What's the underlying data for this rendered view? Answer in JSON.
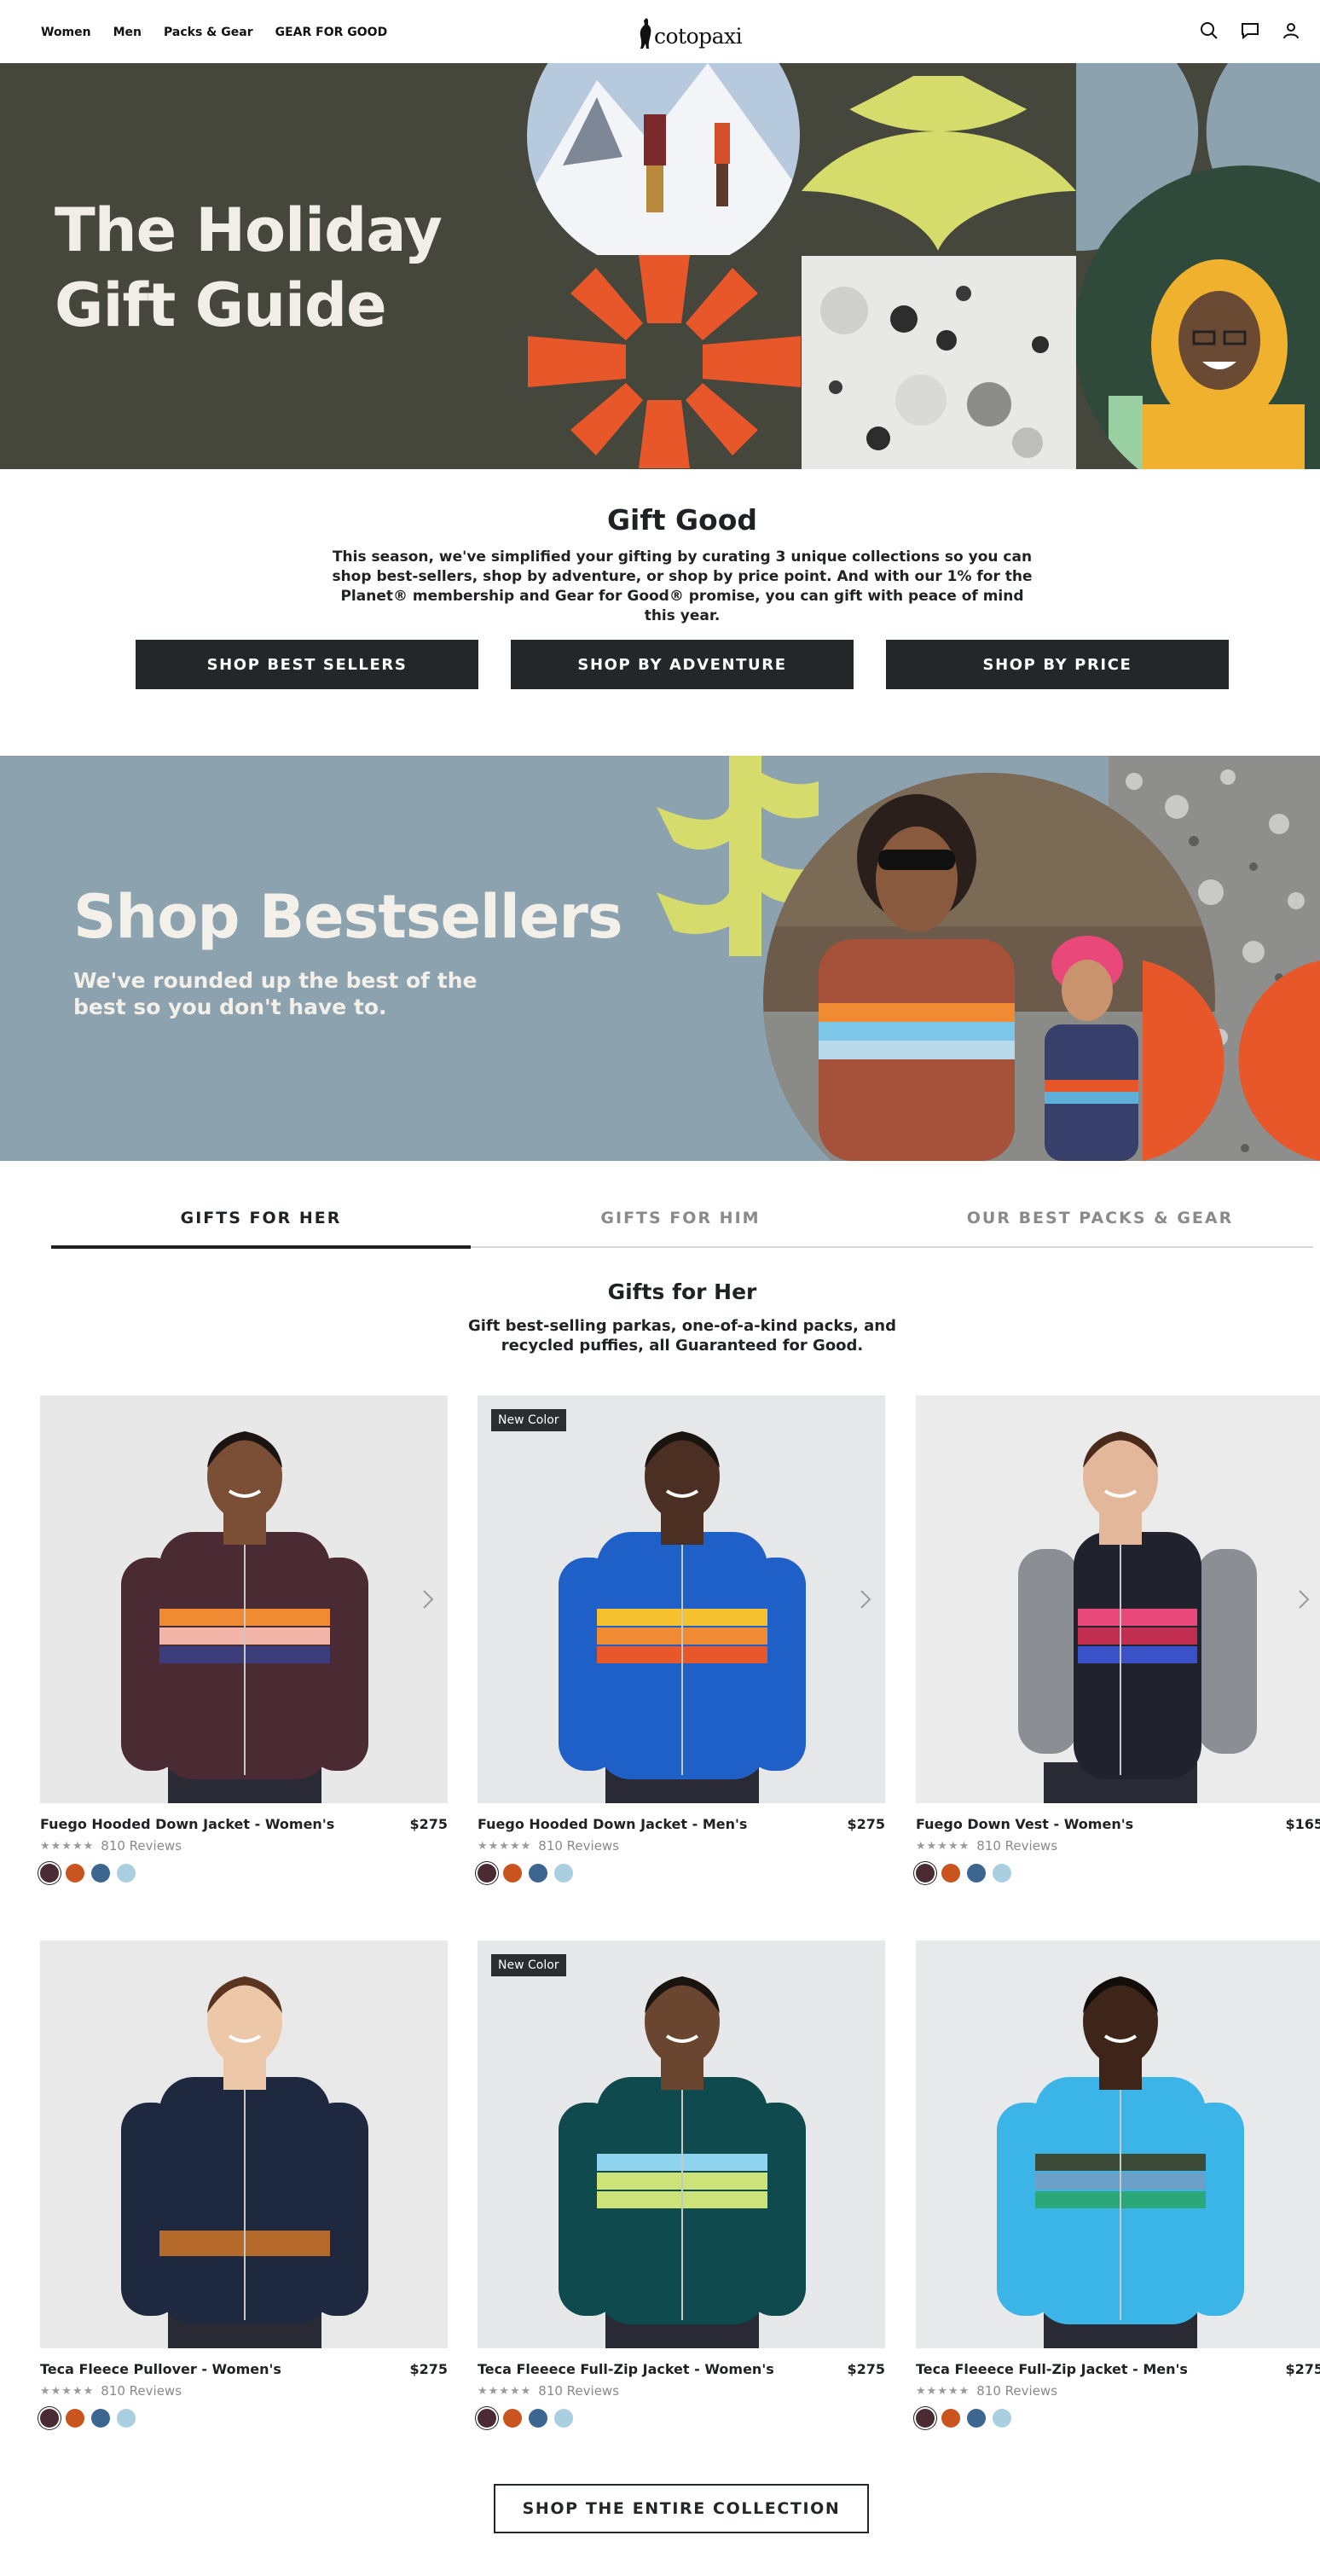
{
  "nav": {
    "links": [
      "Women",
      "Men",
      "Packs & Gear",
      "GEAR FOR GOOD"
    ],
    "logo_text": "cotopaxi",
    "icons": [
      "search-icon",
      "chat-icon",
      "account-icon"
    ]
  },
  "hero": {
    "title": "The Holiday Gift Guide",
    "bg_color": "#45463c"
  },
  "intro": {
    "title": "Gift Good",
    "text": "This season, we've simplified your gifting by curating 3 unique collections so you can shop best-sellers, shop by adventure, or shop by price point. And with our 1% for the Planet® membership and Gear for Good® promise, you can gift with peace of mind this year.",
    "buttons": [
      "SHOP BEST SELLERS",
      "SHOP BY ADVENTURE",
      "SHOP BY PRICE"
    ]
  },
  "banner": {
    "title": "Shop Bestsellers",
    "subtitle": "We've rounded up the best of the best so you don't have to.",
    "bg_color": "#8ca2ae"
  },
  "tabs": {
    "items": [
      "GIFTS FOR HER",
      "GIFTS FOR HIM",
      "OUR BEST PACKS & GEAR"
    ],
    "active": "GIFTS FOR HER"
  },
  "section": {
    "title": "Gifts for Her",
    "text": "Gift best-selling parkas, one-of-a-kind packs, and recycled puffies, all Guaranteed for Good."
  },
  "products": [
    {
      "name": "Fuego Hooded Down Jacket - Women's",
      "price": "$275",
      "rating": 5,
      "reviews": "810 Reviews",
      "badge": ""
    },
    {
      "name": "Fuego Hooded Down Jacket - Men's",
      "price": "$275",
      "rating": 5,
      "reviews": "810 Reviews",
      "badge": "New Color"
    },
    {
      "name": "Fuego Down Vest - Women's",
      "price": "$165",
      "rating": 5,
      "reviews": "810 Reviews",
      "badge": ""
    },
    {
      "name": "Teca Fleece Pullover - Women's",
      "price": "$275",
      "rating": 5,
      "reviews": "810 Reviews",
      "badge": ""
    },
    {
      "name": "Teca Fleeece Full-Zip Jacket - Women's",
      "price": "$275",
      "rating": 5,
      "reviews": "810 Reviews",
      "badge": "New Color"
    },
    {
      "name": "Teca Fleeece Full-Zip Jacket - Men's",
      "price": "$275",
      "rating": 5,
      "reviews": "810 Reviews",
      "badge": ""
    }
  ],
  "swatch_colors": [
    "#4a2a33",
    "#c9541d",
    "#3c6690",
    "#a9cfe0"
  ],
  "cta": {
    "label": "SHOP THE ENTIRE COLLECTION"
  },
  "colors": {
    "accent_orange": "#e8572a",
    "accent_yellow": "#d6dc6c",
    "dark_button": "#24272a"
  }
}
